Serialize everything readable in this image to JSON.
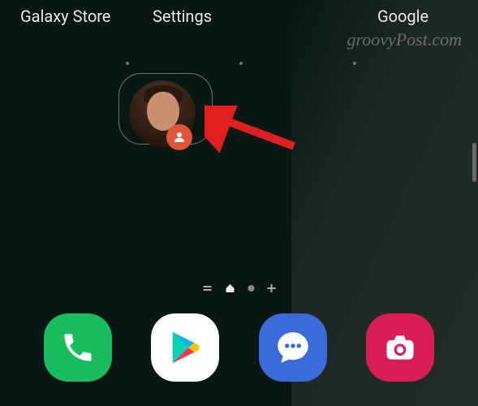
{
  "top_labels": {
    "galaxy_store": "Galaxy Store",
    "settings": "Settings",
    "google": "Google"
  },
  "watermark": "groovyPost.com",
  "contact_widget": {
    "badge_icon": "person-icon"
  },
  "page_indicator": {
    "items": [
      "menu",
      "home",
      "page",
      "add"
    ]
  },
  "dock": {
    "phone": "Phone",
    "play": "Play Store",
    "messages": "Messages",
    "camera": "Camera"
  }
}
